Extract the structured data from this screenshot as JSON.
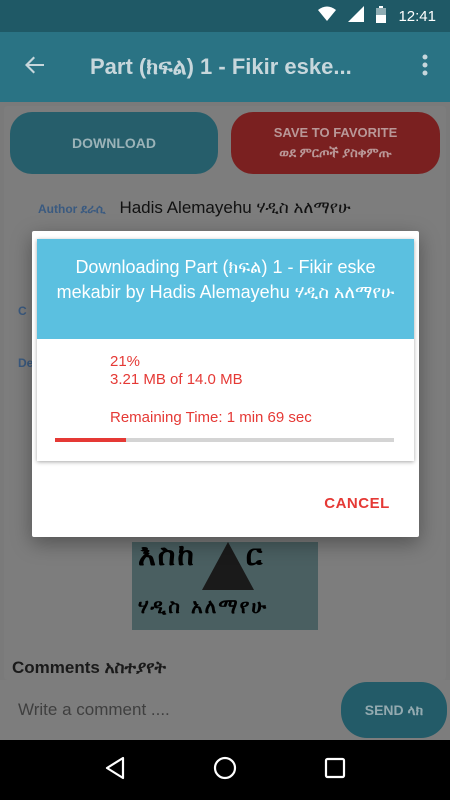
{
  "status_bar": {
    "time": "12:41",
    "icons": [
      "wifi-icon",
      "signal-icon",
      "battery-icon"
    ]
  },
  "app_bar": {
    "title": "Part (ክፍል) 1 - Fikir eske...",
    "back_icon": "arrow-back-icon",
    "menu_icon": "more-vert-icon"
  },
  "actions": {
    "download_label": "DOWNLOAD",
    "favorite_label": "SAVE TO FAVORITE",
    "favorite_label_am": "ወደ ምርጦች ያስቀምጡ"
  },
  "book": {
    "author_label": "Author ደራሲ",
    "author_value": "Hadis Alemayehu ሃዲስ አለማየሁ",
    "partial_label_1": "C",
    "partial_label_2": "De",
    "cover_text_top": "እስከ",
    "cover_text_top_right": "ር",
    "cover_text_bottom": "ሃዲስ  አለማየሁ"
  },
  "comments": {
    "title": "Comments አስተያየት",
    "placeholder": "Write a comment ....",
    "send_label": "SEND ላክ"
  },
  "dialog": {
    "title": "Downloading Part (ክፍል) 1 - Fikir eske mekabir by Hadis Alemayehu ሃዲስ አለማየሁ",
    "percent_text": "21%",
    "sizes_text": "3.21 MB of 14.0 MB",
    "remaining_text": "Remaining Time: 1 min 69 sec",
    "progress_fraction": 0.21,
    "cancel_label": "CANCEL"
  },
  "colors": {
    "accent": "#e53935",
    "header": "#5bc0e0"
  }
}
